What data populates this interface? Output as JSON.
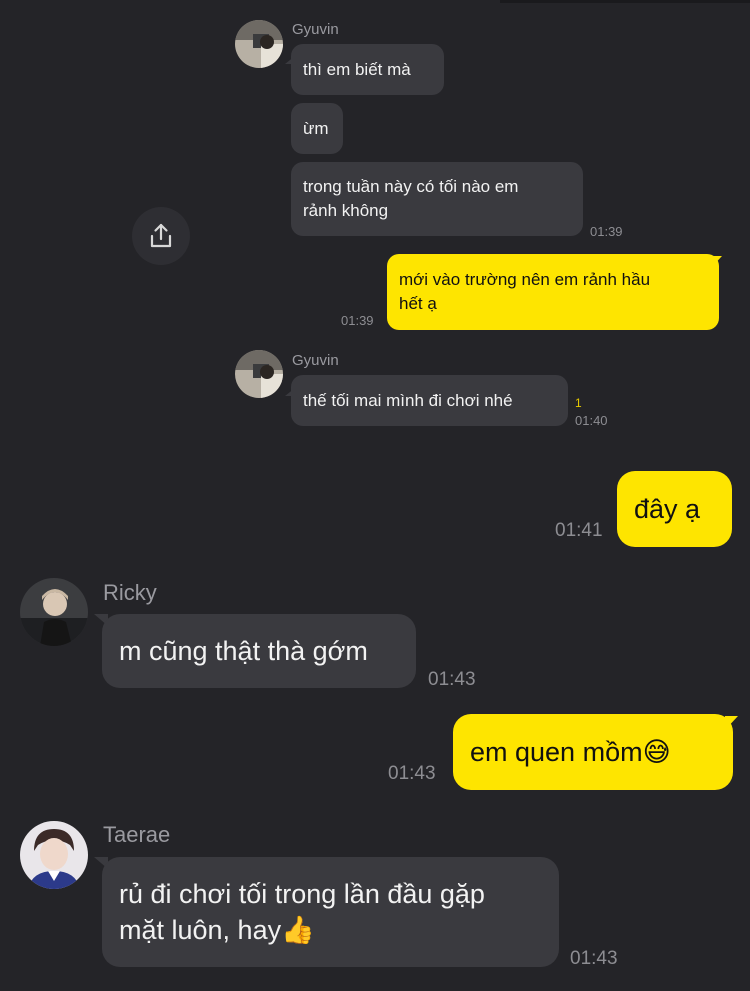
{
  "colors": {
    "background": "#242428",
    "incoming_bubble": "#3a3a3f",
    "outgoing_bubble": "#fee500",
    "timestamp": "#8d8d92",
    "unread": "#e6c800"
  },
  "share_button": {
    "icon": "share-icon"
  },
  "messages": [
    {
      "sender": "Gyuvin",
      "text": "thì em biết mà",
      "direction": "incoming"
    },
    {
      "text": "ừm",
      "direction": "incoming"
    },
    {
      "text": "trong tuần này có tối nào em\nrảnh không",
      "time": "01:39",
      "direction": "incoming"
    },
    {
      "text": "mới vào trường nên em rảnh hầu\nhết ạ",
      "time": "01:39",
      "direction": "outgoing"
    },
    {
      "sender": "Gyuvin",
      "text": "thế tối mai mình đi chơi nhé",
      "time": "01:40",
      "unread": "1",
      "direction": "incoming"
    },
    {
      "text": "đây ạ",
      "time": "01:41",
      "direction": "outgoing"
    },
    {
      "sender": "Ricky",
      "text": "m cũng thật thà gớm",
      "time": "01:43",
      "direction": "incoming"
    },
    {
      "text": "em quen mồm😅",
      "time": "01:43",
      "direction": "outgoing"
    },
    {
      "sender": "Taerae",
      "text": "rủ đi chơi tối trong lần đầu gặp\nmặt luôn, hay👍",
      "time": "01:43",
      "direction": "incoming"
    }
  ]
}
